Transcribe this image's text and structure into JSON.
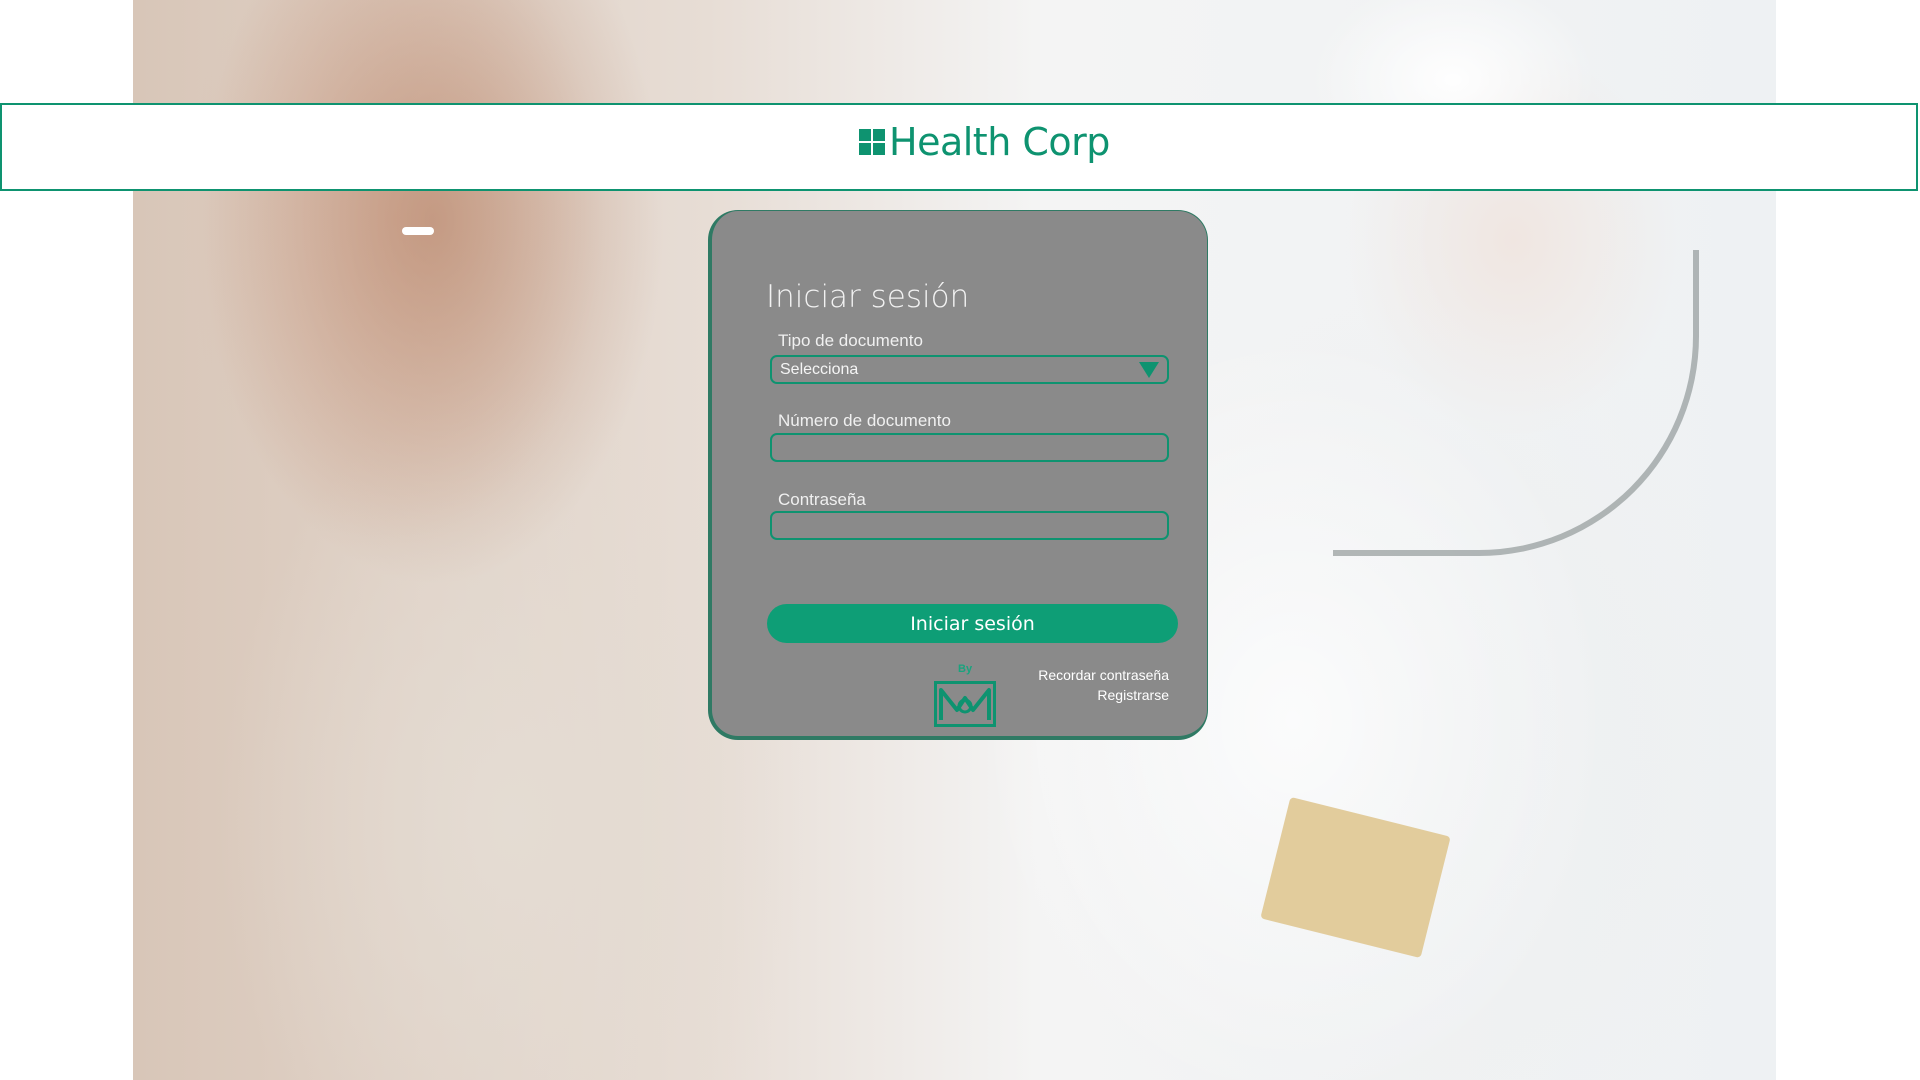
{
  "header": {
    "brand": "Health Corp"
  },
  "login": {
    "title": "Iniciar sesión",
    "document_type_label": "Tipo de documento",
    "document_type_value": "Selecciona",
    "document_number_label": "Número de documento",
    "document_number_value": "",
    "password_label": "Contraseña",
    "password_value": "",
    "submit_label": "Iniciar sesión",
    "remember_password_link": "Recordar contraseña",
    "register_link": "Registrarse",
    "by_label": "By"
  },
  "icons": {
    "brand": "medical-cross-icon",
    "select": "chevron-down-icon",
    "maker": "mn-logo"
  },
  "colors": {
    "accent": "#0e9370",
    "button": "#0e9e76",
    "card": "#8a8a8a"
  }
}
